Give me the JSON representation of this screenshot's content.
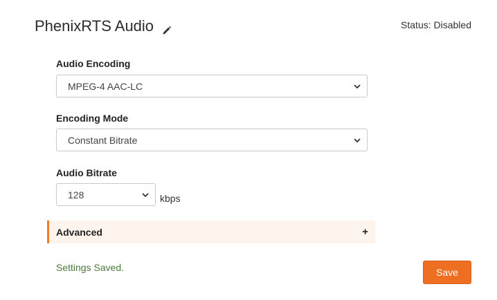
{
  "header": {
    "title": "PhenixRTS Audio",
    "status": "Status: Disabled"
  },
  "form": {
    "audio_encoding": {
      "label": "Audio Encoding",
      "value": "MPEG-4 AAC-LC"
    },
    "encoding_mode": {
      "label": "Encoding Mode",
      "value": "Constant Bitrate"
    },
    "audio_bitrate": {
      "label": "Audio Bitrate",
      "value": "128",
      "unit": "kbps"
    }
  },
  "advanced": {
    "label": "Advanced",
    "toggle": "+"
  },
  "footer": {
    "message": "Settings Saved.",
    "save_label": "Save"
  },
  "colors": {
    "accent": "#ee6e22",
    "advanced_bg": "#fdf4ee",
    "success_text": "#4a7a3a"
  }
}
